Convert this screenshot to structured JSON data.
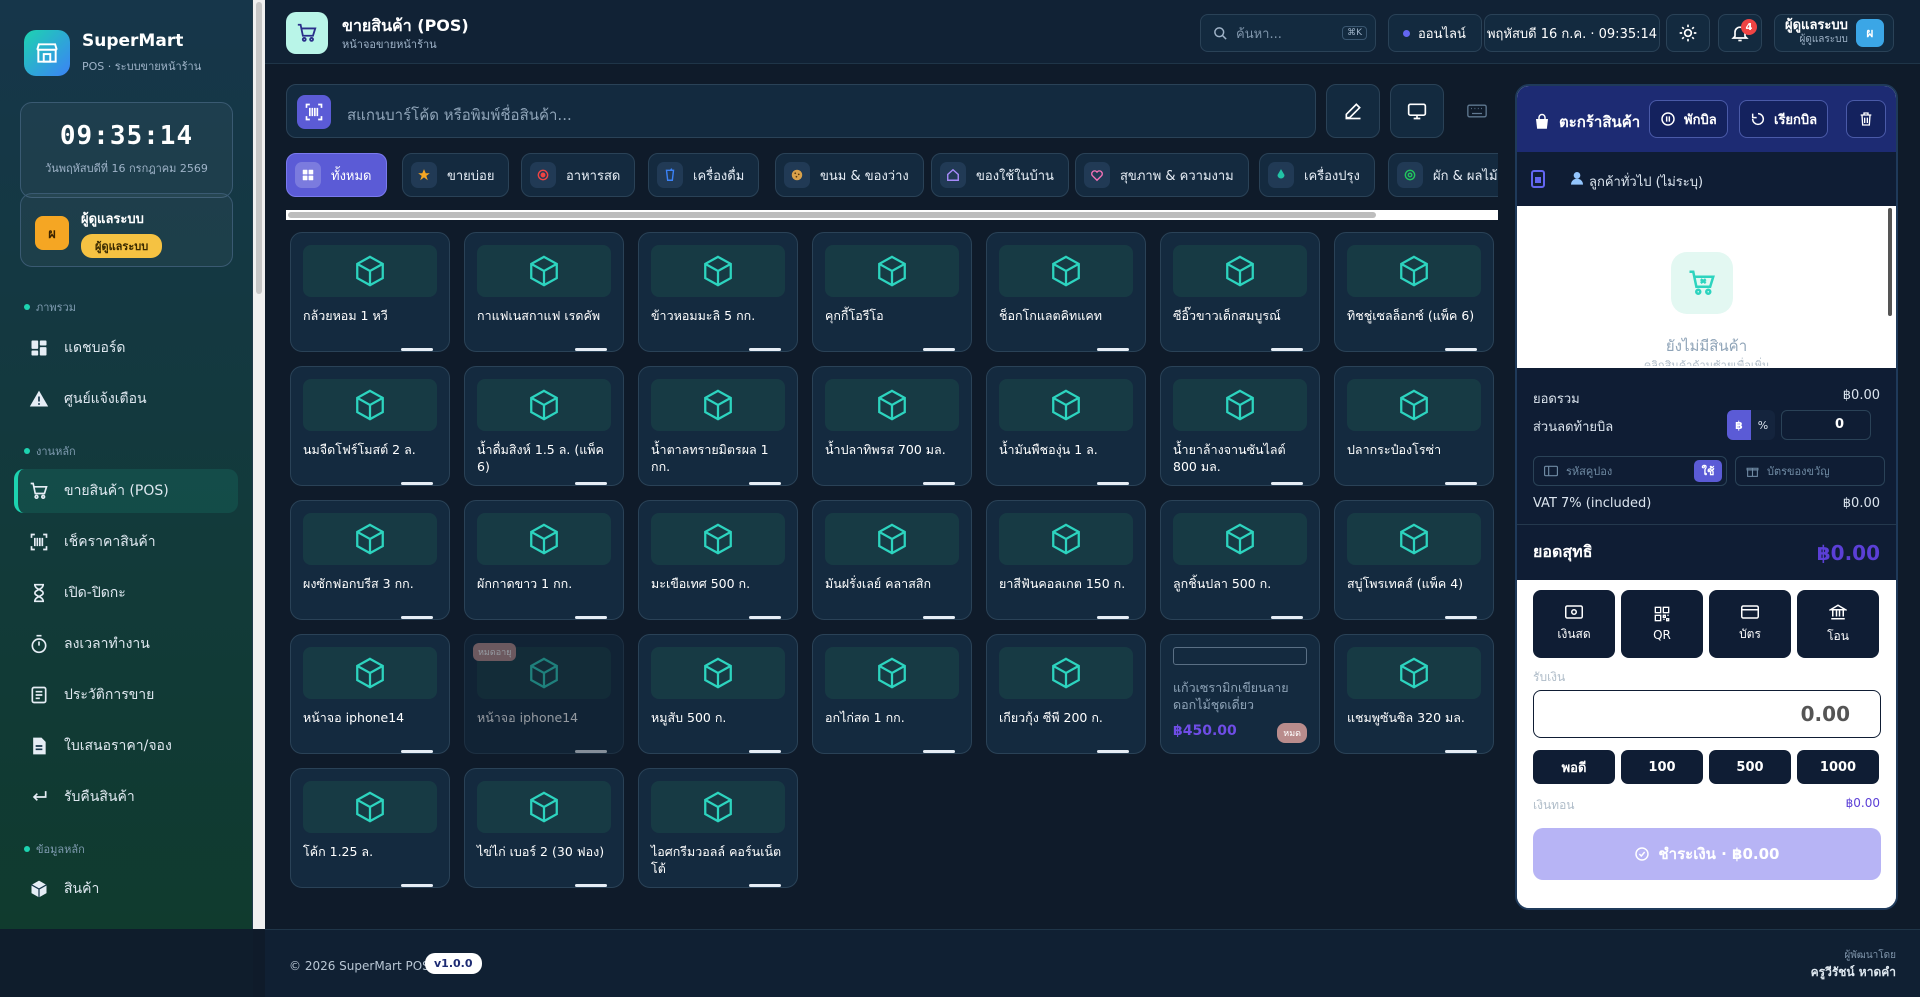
{
  "app": {
    "name": "SuperMart",
    "subtitle": "POS · ระบบขายหน้าร้าน"
  },
  "clock": {
    "time": "09:35:14",
    "date": "วันพฤหัสบดีที่ 16 กรกฎาคม 2569"
  },
  "user": {
    "avatar": "ผ",
    "name": "ผู้ดูแลระบบ",
    "role": "ผู้ดูแลระบบ"
  },
  "sidebar": {
    "sections": [
      {
        "label": "ภาพรวม"
      },
      {
        "label": "งานหลัก"
      },
      {
        "label": "ข้อมูลหลัก"
      }
    ],
    "items": [
      {
        "label": "แดชบอร์ด",
        "icon": "dashboard-icon"
      },
      {
        "label": "ศูนย์แจ้งเตือน",
        "icon": "warning-icon"
      },
      {
        "label": "ขายสินค้า (POS)",
        "icon": "cart-icon",
        "active": true
      },
      {
        "label": "เช็คราคาสินค้า",
        "icon": "barcode-icon"
      },
      {
        "label": "เปิด-ปิดกะ",
        "icon": "hourglass-icon"
      },
      {
        "label": "ลงเวลาทำงาน",
        "icon": "stopwatch-icon"
      },
      {
        "label": "ประวัติการขาย",
        "icon": "receipt-icon"
      },
      {
        "label": "ใบเสนอราคา/จอง",
        "icon": "document-icon"
      },
      {
        "label": "รับคืนสินค้า",
        "icon": "return-icon"
      },
      {
        "label": "สินค้า",
        "icon": "box-icon"
      }
    ]
  },
  "header": {
    "title": "ขายสินค้า (POS)",
    "subtitle": "หน้าจอขายหน้าร้าน",
    "search_placeholder": "ค้นหา...",
    "search_shortcut": "⌘K",
    "status": "ออนไลน์",
    "datetime": "พฤหัสบดี 16 ก.ค. · 09:35:14",
    "notifications": "4",
    "user_name": "ผู้ดูแลระบบ",
    "user_role": "ผู้ดูแลระบบ",
    "user_avatar": "ผ"
  },
  "scan": {
    "placeholder": "สแกนบาร์โค้ด หรือพิมพ์ชื่อสินค้า..."
  },
  "categories": [
    {
      "label": "ทั้งหมด",
      "icon": "grid-icon",
      "active": true
    },
    {
      "label": "ขายบ่อย",
      "icon": "star-icon"
    },
    {
      "label": "อาหารสด",
      "icon": "fresh-food-icon"
    },
    {
      "label": "เครื่องดื่ม",
      "icon": "drink-icon"
    },
    {
      "label": "ขนม & ของว่าง",
      "icon": "cookie-icon"
    },
    {
      "label": "ของใช้ในบ้าน",
      "icon": "home-icon"
    },
    {
      "label": "สุขภาพ & ความงาม",
      "icon": "heart-icon"
    },
    {
      "label": "เครื่องปรุง",
      "icon": "drop-icon"
    },
    {
      "label": "ผัก & ผลไม้",
      "icon": "leaf-icon"
    }
  ],
  "products": [
    {
      "name": "กล้วยหอม 1 หวี"
    },
    {
      "name": "กาแฟเนสกาแฟ เรดคัพ"
    },
    {
      "name": "ข้าวหอมมะลิ 5 กก."
    },
    {
      "name": "คุกกี้โอรีโอ"
    },
    {
      "name": "ช็อกโกแลตคิทแคท"
    },
    {
      "name": "ซีอิ๊วขาวเด็กสมบูรณ์"
    },
    {
      "name": "ทิชชู่เซลล็อกซ์ (แพ็ค 6)"
    },
    {
      "name": "นมจืดโฟร์โมสต์ 2 ล."
    },
    {
      "name": "น้ำดื่มสิงห์ 1.5 ล. (แพ็ค 6)"
    },
    {
      "name": "น้ำตาลทรายมิตรผล 1 กก."
    },
    {
      "name": "น้ำปลาทิพรส 700 มล."
    },
    {
      "name": "น้ำมันพืชองุ่น 1 ล."
    },
    {
      "name": "น้ำยาล้างจานซันไลต์ 800 มล."
    },
    {
      "name": "ปลากระป๋องโรซ่า"
    },
    {
      "name": "ผงซักฟอกบรีส 3 กก."
    },
    {
      "name": "ผักกาดขาว 1 กก."
    },
    {
      "name": "มะเขือเทศ 500 ก."
    },
    {
      "name": "มันฝรั่งเลย์ คลาสสิก"
    },
    {
      "name": "ยาสีฟันคอลเกต 150 ก."
    },
    {
      "name": "ลูกชิ้นปลา 500 ก."
    },
    {
      "name": "สบู่โพรเทคส์ (แพ็ค 4)"
    },
    {
      "name": "หน้าจอ iphone14"
    },
    {
      "name": "หน้าจอ iphone14",
      "out_of_stock": true,
      "badge": "หมดอายุ"
    },
    {
      "name": "หมูสับ 500 ก."
    },
    {
      "name": "อกไก่สด 1 กก."
    },
    {
      "name": "เกียวกุ้ง ซีพี 200 ก."
    },
    {
      "name": "แก้วเซรามิกเขียนลายดอกไม้ชุดเดี่ยว",
      "price": "฿450.00",
      "stock_badge": "หมด",
      "image_broken": true
    },
    {
      "name": "แชมพูซันซิล 320 มล."
    },
    {
      "name": "โค้ก 1.25 ล."
    },
    {
      "name": "ไข่ไก่ เบอร์ 2 (30 ฟอง)"
    },
    {
      "name": "ไอศกรีมวอลล์ คอร์นเน็ตโต้"
    }
  ],
  "footer": {
    "copyright": "© 2026 SuperMart POS",
    "version": "v1.0.0",
    "dev_label": "ผู้พัฒนาโดย",
    "dev_name": "ครูวีรัชน์ หาดคำ"
  },
  "cart": {
    "title": "ตะกร้าสินค้า",
    "hold_label": "พักบิล",
    "recall_label": "เรียกบิล",
    "customer": "ลูกค้าทั่วไป (ไม่ระบุ)",
    "empty_title": "ยังไม่มีสินค้า",
    "empty_hint": "คลิกสินค้าด้านซ้ายเพื่อเพิ่ม",
    "subtotal_label": "ยอดรวม",
    "subtotal": "฿0.00",
    "discount_label": "ส่วนลดท้ายบิล",
    "discount_baht": "฿",
    "discount_pct": "%",
    "discount_value": "0",
    "coupon_placeholder": "รหัสคูปอง",
    "coupon_apply": "ใช้",
    "gift_placeholder": "บัตรของขวัญ",
    "vat_label": "VAT 7% (included)",
    "vat": "฿0.00",
    "net_label": "ยอดสุทธิ",
    "net": "฿0.00",
    "pay_methods": [
      {
        "label": "เงินสด",
        "icon": "cash-icon"
      },
      {
        "label": "QR",
        "icon": "qr-icon"
      },
      {
        "label": "บัตร",
        "icon": "card-icon"
      },
      {
        "label": "โอน",
        "icon": "bank-icon"
      }
    ],
    "received_label": "รับเงิน",
    "received": "0.00",
    "quick_amounts": [
      "พอดี",
      "100",
      "500",
      "1000"
    ],
    "change_label": "เงินทอน",
    "change": "฿0.00",
    "checkout": "ชำระเงิน · ฿0.00"
  }
}
